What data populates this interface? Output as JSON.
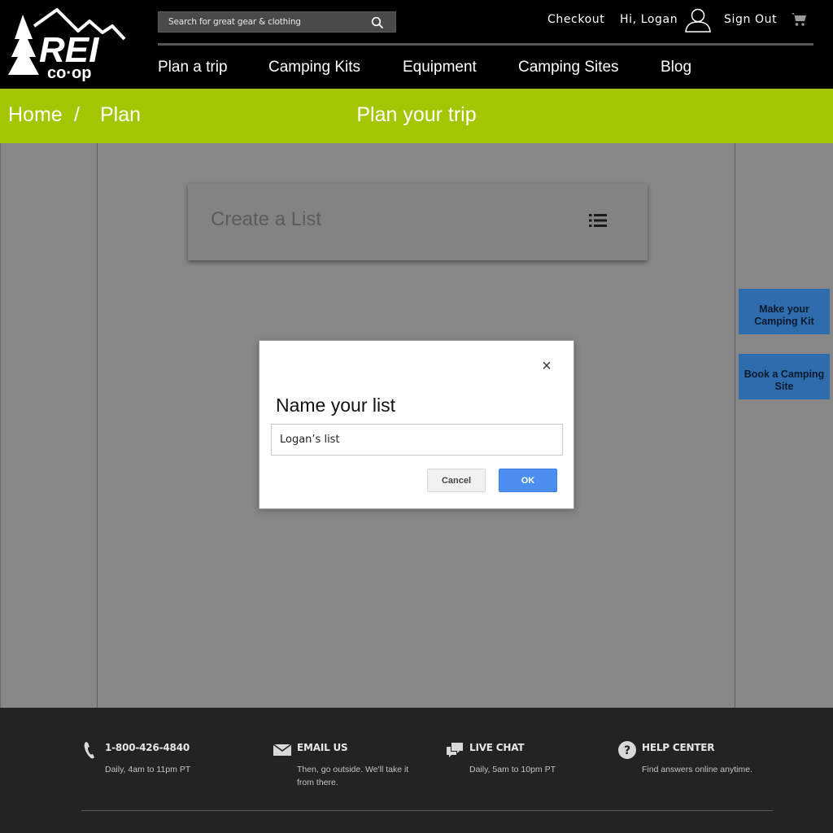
{
  "header": {
    "search": {
      "placeholder": "Search for great gear & clothing"
    },
    "links": {
      "checkout": "Checkout",
      "greeting": "Hi, Logan",
      "sign_out": "Sign Out"
    },
    "nav": [
      "Plan a trip",
      "Camping Kits",
      "Equipment",
      "Camping Sites",
      "Blog"
    ]
  },
  "breadcrumb": {
    "home": "Home",
    "separator": "/",
    "current": "Plan",
    "page_title": "Plan your trip"
  },
  "main": {
    "create_list_label": "Create a List",
    "side_buttons": [
      "Make your Camping Kit",
      "Book a Camping Site"
    ]
  },
  "modal": {
    "close": "×",
    "title": "Name your list",
    "input_value": "Logan’s list",
    "cancel": "Cancel",
    "ok": "OK"
  },
  "footer": {
    "items": [
      {
        "title": "1-800-426-4840",
        "desc": "Daily, 4am to 11pm PT"
      },
      {
        "title": "EMAIL US",
        "desc": "Then, go outside. We'll take it from there."
      },
      {
        "title": "LIVE CHAT",
        "desc": "Daily, 5am to 10pm PT"
      },
      {
        "title": "HELP CENTER",
        "desc": "Find answers online anytime."
      }
    ]
  },
  "colors": {
    "brand_green": "#a3c600",
    "side_button_blue": "#2e6cad",
    "ok_blue": "#4d8ff0"
  },
  "icons": [
    "rei-logo",
    "search-icon",
    "user-icon",
    "cart-icon",
    "list-icon",
    "close-icon",
    "phone-icon",
    "mail-icon",
    "chat-icon",
    "help-icon"
  ]
}
